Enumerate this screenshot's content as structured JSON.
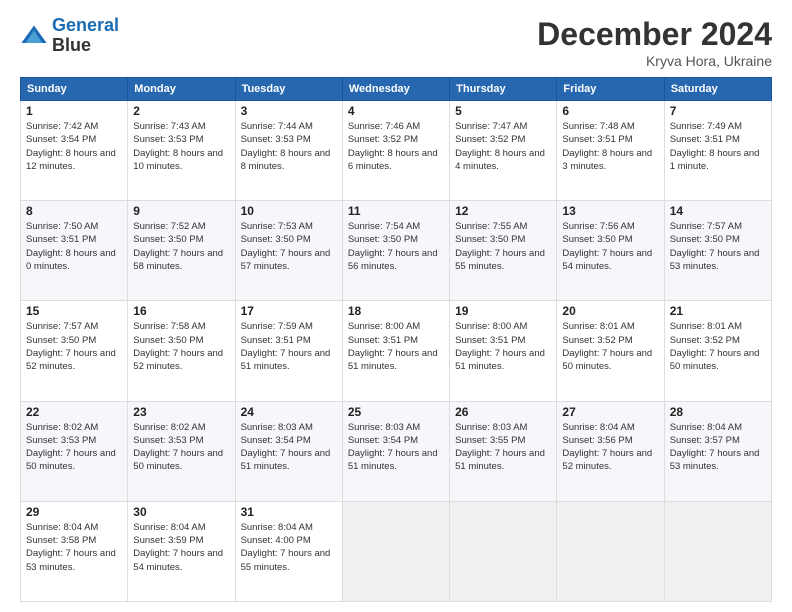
{
  "header": {
    "logo_line1": "General",
    "logo_line2": "Blue",
    "month": "December 2024",
    "location": "Kryva Hora, Ukraine"
  },
  "weekdays": [
    "Sunday",
    "Monday",
    "Tuesday",
    "Wednesday",
    "Thursday",
    "Friday",
    "Saturday"
  ],
  "weeks": [
    [
      {
        "day": "1",
        "rise": "7:42 AM",
        "set": "3:54 PM",
        "daylight": "8 hours and 12 minutes."
      },
      {
        "day": "2",
        "rise": "7:43 AM",
        "set": "3:53 PM",
        "daylight": "8 hours and 10 minutes."
      },
      {
        "day": "3",
        "rise": "7:44 AM",
        "set": "3:53 PM",
        "daylight": "8 hours and 8 minutes."
      },
      {
        "day": "4",
        "rise": "7:46 AM",
        "set": "3:52 PM",
        "daylight": "8 hours and 6 minutes."
      },
      {
        "day": "5",
        "rise": "7:47 AM",
        "set": "3:52 PM",
        "daylight": "8 hours and 4 minutes."
      },
      {
        "day": "6",
        "rise": "7:48 AM",
        "set": "3:51 PM",
        "daylight": "8 hours and 3 minutes."
      },
      {
        "day": "7",
        "rise": "7:49 AM",
        "set": "3:51 PM",
        "daylight": "8 hours and 1 minute."
      }
    ],
    [
      {
        "day": "8",
        "rise": "7:50 AM",
        "set": "3:51 PM",
        "daylight": "8 hours and 0 minutes."
      },
      {
        "day": "9",
        "rise": "7:52 AM",
        "set": "3:50 PM",
        "daylight": "7 hours and 58 minutes."
      },
      {
        "day": "10",
        "rise": "7:53 AM",
        "set": "3:50 PM",
        "daylight": "7 hours and 57 minutes."
      },
      {
        "day": "11",
        "rise": "7:54 AM",
        "set": "3:50 PM",
        "daylight": "7 hours and 56 minutes."
      },
      {
        "day": "12",
        "rise": "7:55 AM",
        "set": "3:50 PM",
        "daylight": "7 hours and 55 minutes."
      },
      {
        "day": "13",
        "rise": "7:56 AM",
        "set": "3:50 PM",
        "daylight": "7 hours and 54 minutes."
      },
      {
        "day": "14",
        "rise": "7:57 AM",
        "set": "3:50 PM",
        "daylight": "7 hours and 53 minutes."
      }
    ],
    [
      {
        "day": "15",
        "rise": "7:57 AM",
        "set": "3:50 PM",
        "daylight": "7 hours and 52 minutes."
      },
      {
        "day": "16",
        "rise": "7:58 AM",
        "set": "3:50 PM",
        "daylight": "7 hours and 52 minutes."
      },
      {
        "day": "17",
        "rise": "7:59 AM",
        "set": "3:51 PM",
        "daylight": "7 hours and 51 minutes."
      },
      {
        "day": "18",
        "rise": "8:00 AM",
        "set": "3:51 PM",
        "daylight": "7 hours and 51 minutes."
      },
      {
        "day": "19",
        "rise": "8:00 AM",
        "set": "3:51 PM",
        "daylight": "7 hours and 51 minutes."
      },
      {
        "day": "20",
        "rise": "8:01 AM",
        "set": "3:52 PM",
        "daylight": "7 hours and 50 minutes."
      },
      {
        "day": "21",
        "rise": "8:01 AM",
        "set": "3:52 PM",
        "daylight": "7 hours and 50 minutes."
      }
    ],
    [
      {
        "day": "22",
        "rise": "8:02 AM",
        "set": "3:53 PM",
        "daylight": "7 hours and 50 minutes."
      },
      {
        "day": "23",
        "rise": "8:02 AM",
        "set": "3:53 PM",
        "daylight": "7 hours and 50 minutes."
      },
      {
        "day": "24",
        "rise": "8:03 AM",
        "set": "3:54 PM",
        "daylight": "7 hours and 51 minutes."
      },
      {
        "day": "25",
        "rise": "8:03 AM",
        "set": "3:54 PM",
        "daylight": "7 hours and 51 minutes."
      },
      {
        "day": "26",
        "rise": "8:03 AM",
        "set": "3:55 PM",
        "daylight": "7 hours and 51 minutes."
      },
      {
        "day": "27",
        "rise": "8:04 AM",
        "set": "3:56 PM",
        "daylight": "7 hours and 52 minutes."
      },
      {
        "day": "28",
        "rise": "8:04 AM",
        "set": "3:57 PM",
        "daylight": "7 hours and 53 minutes."
      }
    ],
    [
      {
        "day": "29",
        "rise": "8:04 AM",
        "set": "3:58 PM",
        "daylight": "7 hours and 53 minutes."
      },
      {
        "day": "30",
        "rise": "8:04 AM",
        "set": "3:59 PM",
        "daylight": "7 hours and 54 minutes."
      },
      {
        "day": "31",
        "rise": "8:04 AM",
        "set": "4:00 PM",
        "daylight": "7 hours and 55 minutes."
      },
      null,
      null,
      null,
      null
    ]
  ]
}
